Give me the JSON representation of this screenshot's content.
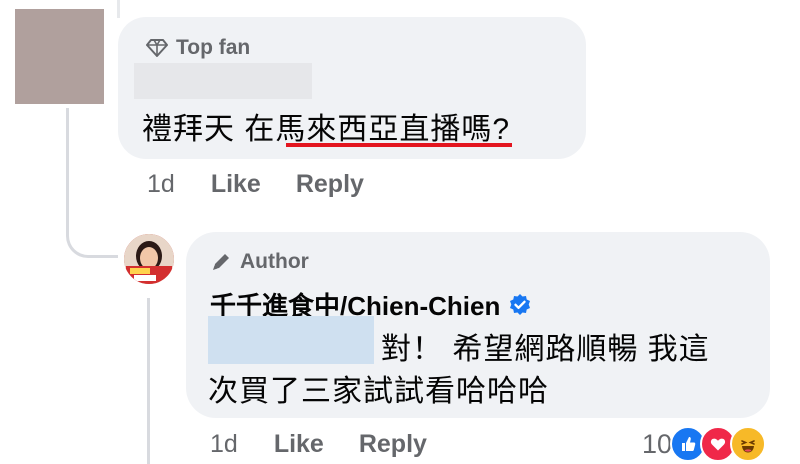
{
  "comment": {
    "badge_icon": "diamond-icon",
    "badge": "Top fan",
    "text": "禮拜天 在馬來西亞直播嗎?",
    "time": "1d",
    "like": "Like",
    "reply": "Reply"
  },
  "reply": {
    "badge_icon": "pencil-icon",
    "badge": "Author",
    "author_name": "千千進食中/Chien-Chien",
    "verified_icon": "verified-badge-icon",
    "text_line1": "對！ 希望網路順暢 我這",
    "text_line2": "次買了三家試試看哈哈哈",
    "time": "1d",
    "like": "Like",
    "reply": "Reply",
    "reaction_count": "10",
    "reactions": [
      "like-reaction-icon",
      "love-reaction-icon",
      "haha-reaction-icon"
    ]
  },
  "colors": {
    "bubble": "#f0f2f5",
    "secondary_text": "#65676b",
    "underline": "#e3151f",
    "verified": "#1877f2"
  }
}
